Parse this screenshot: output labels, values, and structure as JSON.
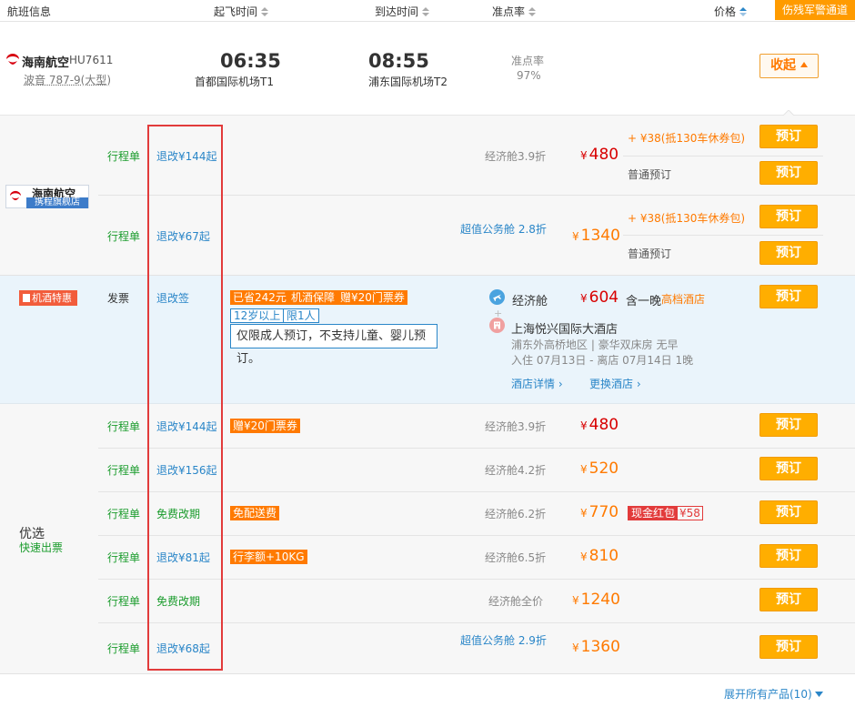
{
  "header": {
    "flight_info": "航班信息",
    "depart_time": "起飞时间",
    "arrive_time": "到达时间",
    "ontime_rate": "准点率",
    "price": "价格",
    "special_channel": "伤残军警通道"
  },
  "flight": {
    "airline": "海南航空",
    "flight_no": "HU7611",
    "aircraft": "波音 787-9(大型)",
    "depart_time": "06:35",
    "depart_airport": "首都国际机场T1",
    "arrive_time": "08:55",
    "arrive_airport": "浦东国际机场T2",
    "ontime_label": "准点率",
    "ontime_value": "97%",
    "collapse_label": "收起"
  },
  "hainan_store": {
    "name": "海南航空",
    "subtitle": "携程旗舰店",
    "rows": [
      {
        "ticket": "行程单",
        "refund": "退改¥144起",
        "cabin": "经济舱3.9折",
        "currency": "¥",
        "price": "480",
        "promo": "+ ¥38(抵130车休券包)",
        "normal": "普通预订",
        "book": "预订"
      },
      {
        "ticket": "行程单",
        "refund": "退改¥67起",
        "cabin": "超值公务舱 2.8折",
        "currency": "¥",
        "price": "1340",
        "promo": "+ ¥38(抵130车休券包)",
        "normal": "普通预订",
        "book": "预订"
      }
    ]
  },
  "package": {
    "badge": "机酒特惠",
    "ticket": "发票",
    "refund": "退改签",
    "tags": [
      "已省242元",
      "机酒保障",
      "赠¥20门票券"
    ],
    "age_tags": [
      "12岁以上",
      "限1人"
    ],
    "tip": "仅限成人预订，不支持儿童、婴儿预订。",
    "cabin": "经济舱",
    "currency": "¥",
    "price": "604",
    "stay": "含一晚",
    "hotel_level": "高档酒店",
    "hotel_name": "上海悦兴国际大酒店",
    "hotel_detail": "浦东外高桥地区 | 豪华双床房 无早",
    "checkin": "入住 07月13日 - 离店 07月14日  1晚",
    "hotel_detail_link": "酒店详情",
    "change_hotel_link": "更换酒店",
    "book": "预订"
  },
  "preferred": {
    "title": "优选",
    "subtitle": "快速出票",
    "rows": [
      {
        "ticket": "行程单",
        "refund": "退改¥144起",
        "tag": "赠¥20门票券",
        "cabin": "经济舱3.9折",
        "currency": "¥",
        "price": "480",
        "book": "预订"
      },
      {
        "ticket": "行程单",
        "refund": "退改¥156起",
        "tag": "",
        "cabin": "经济舱4.2折",
        "currency": "¥",
        "price": "520",
        "book": "预订"
      },
      {
        "ticket": "行程单",
        "refund": "免费改期",
        "tag": "免配送费",
        "cabin": "经济舱6.2折",
        "currency": "¥",
        "price": "770",
        "cash_tag": "现金红包",
        "cash_value": "¥58",
        "book": "预订"
      },
      {
        "ticket": "行程单",
        "refund": "退改¥81起",
        "tag": "行李额+10KG",
        "cabin": "经济舱6.5折",
        "currency": "¥",
        "price": "810",
        "book": "预订"
      },
      {
        "ticket": "行程单",
        "refund": "免费改期",
        "tag": "",
        "cabin": "经济舱全价",
        "currency": "¥",
        "price": "1240",
        "book": "预订"
      },
      {
        "ticket": "行程单",
        "refund": "退改¥68起",
        "tag": "",
        "cabin": "超值公务舱 2.9折",
        "currency": "¥",
        "price": "1360",
        "book": "预订"
      }
    ]
  },
  "footer": {
    "expand_label": "展开所有产品(10)"
  },
  "colors": {
    "accent_orange": "#ff9b00",
    "link_blue": "#2a86c8",
    "highlight_red": "#e23b3b"
  }
}
